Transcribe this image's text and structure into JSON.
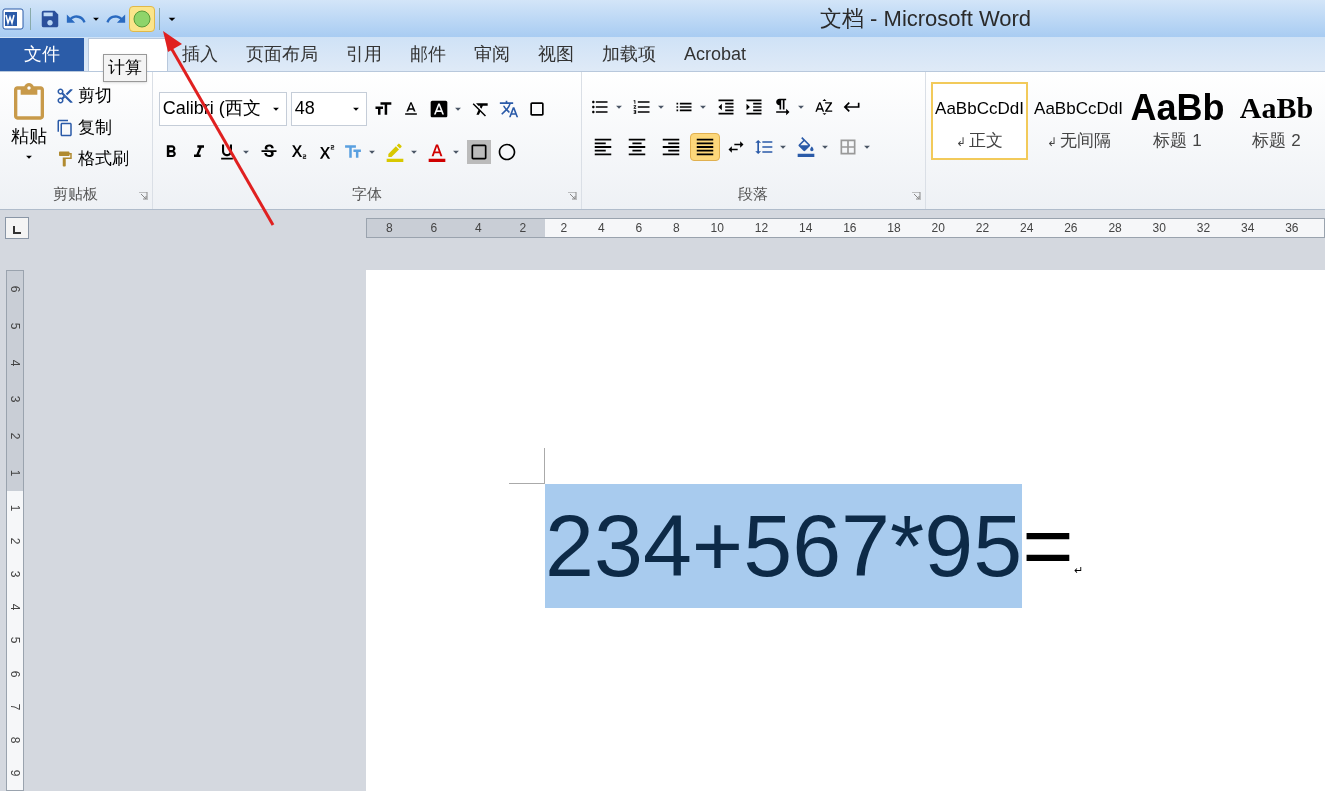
{
  "window": {
    "title": "文档 - Microsoft Word"
  },
  "quick_access": [
    {
      "kind": "save",
      "highlighted": false
    },
    {
      "kind": "undo",
      "highlighted": false
    },
    {
      "kind": "redo",
      "highlighted": false
    },
    {
      "kind": "calc",
      "highlighted": true
    }
  ],
  "tooltip": "计算",
  "tabs": [
    {
      "label": "文件",
      "kind": "file",
      "selected": false
    },
    {
      "kind": "tab",
      "selected": true
    },
    {
      "label": "插入",
      "kind": "tab",
      "selected": false
    },
    {
      "label": "页面布局",
      "kind": "tab",
      "selected": false
    },
    {
      "label": "引用",
      "kind": "tab",
      "selected": false
    },
    {
      "label": "邮件",
      "kind": "tab",
      "selected": false
    },
    {
      "label": "审阅",
      "kind": "tab",
      "selected": false
    },
    {
      "label": "视图",
      "kind": "tab",
      "selected": false
    },
    {
      "label": "加载项",
      "kind": "tab",
      "selected": false
    },
    {
      "label": "Acrobat",
      "kind": "tab",
      "selected": false
    }
  ],
  "clipboard": {
    "paste": "粘贴",
    "cut": "剪切",
    "copy": "复制",
    "format_painter": "格式刷",
    "group_label": "剪贴板"
  },
  "font": {
    "name": "Calibri (西文",
    "size": "48",
    "group_label": "字体"
  },
  "paragraph": {
    "group_label": "段落",
    "alignments": [
      {
        "kind": "left",
        "selected": false
      },
      {
        "kind": "center",
        "selected": false
      },
      {
        "kind": "right",
        "selected": false
      },
      {
        "kind": "justify",
        "selected": true
      }
    ]
  },
  "styles": [
    {
      "preview": "AaBbCcDdI",
      "name": "正文",
      "mark": "↲",
      "kind": "normal",
      "selected": true
    },
    {
      "preview": "AaBbCcDdI",
      "name": "无间隔",
      "mark": "↲",
      "kind": "normal",
      "selected": false
    },
    {
      "preview": "AaBb",
      "name": "标题 1",
      "kind": "heading1",
      "selected": false
    },
    {
      "preview": "AaBb",
      "name": "标题 2",
      "kind": "heading2",
      "selected": false
    }
  ],
  "horizontal_ruler": {
    "left_ticks": [
      "8",
      "6",
      "4",
      "2"
    ],
    "ticks": [
      "2",
      "4",
      "6",
      "8",
      "10",
      "12",
      "14",
      "16",
      "18",
      "20",
      "22",
      "24",
      "26",
      "28",
      "30",
      "32",
      "34",
      "36"
    ]
  },
  "vertical_ruler": {
    "top_ticks": [
      "6",
      "5",
      "4",
      "3",
      "2",
      "1"
    ],
    "ticks": [
      "1",
      "2",
      "3",
      "4",
      "5",
      "6",
      "7",
      "8",
      "9"
    ]
  },
  "document": {
    "runs": [
      {
        "text": "234+567*95",
        "selected": true
      },
      {
        "text": "=",
        "selected": false
      }
    ],
    "paragraph_mark": "↵"
  }
}
